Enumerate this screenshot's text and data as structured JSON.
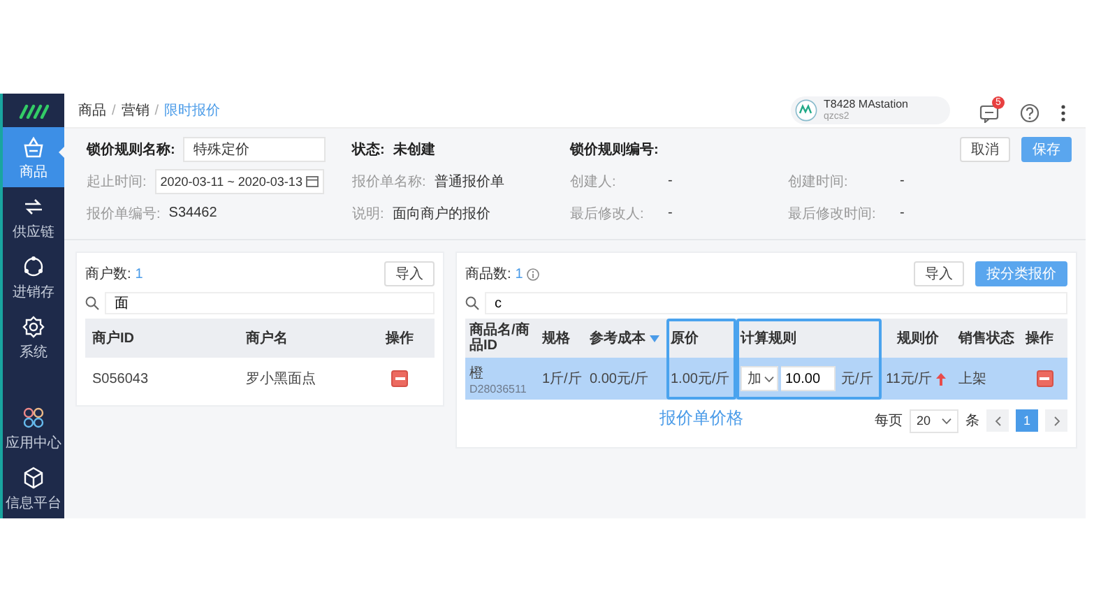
{
  "sidebar": {
    "items": [
      {
        "label": "商品",
        "selected": true
      },
      {
        "label": "供应链",
        "selected": false
      },
      {
        "label": "进销存",
        "selected": false
      },
      {
        "label": "系统",
        "selected": false
      }
    ],
    "bottom_items": [
      {
        "label": "应用中心",
        "selected": false
      },
      {
        "label": "信息平台",
        "selected": false
      }
    ]
  },
  "breadcrumb": {
    "separator": "/",
    "items": [
      {
        "label": "商品",
        "current": false
      },
      {
        "label": "营销",
        "current": false
      },
      {
        "label": "限时报价",
        "current": true
      }
    ]
  },
  "account": {
    "name": "T8428 MAstation",
    "sub": "qzcs2"
  },
  "notifications": {
    "badge": "5"
  },
  "form": {
    "name_label": "锁价规则名称:",
    "name_value": "特殊定价",
    "status_label": "状态:",
    "status_value": "未创建",
    "code_label": "锁价规则编号:",
    "fields": [
      {
        "label": "起止时间:",
        "value": "2020-03-11 ~ 2020-03-13",
        "kind": "date"
      },
      {
        "label": "报价单名称:",
        "value": "普通报价单",
        "kind": "text"
      },
      {
        "label": "创建人:",
        "value": "-",
        "kind": "text"
      },
      {
        "label": "创建时间:",
        "value": "-",
        "kind": "text"
      },
      {
        "label": "报价单编号:",
        "value": "S34462",
        "kind": "text"
      },
      {
        "label": "说明:",
        "value": "面向商户的报价",
        "kind": "text"
      },
      {
        "label": "最后修改人:",
        "value": "-",
        "kind": "text"
      },
      {
        "label": "最后修改时间:",
        "value": "-",
        "kind": "text"
      }
    ]
  },
  "actions": [
    {
      "label": "取消",
      "primary": false
    },
    {
      "label": "保存",
      "primary": true
    }
  ],
  "merchants": {
    "count_label": "商户数:",
    "count": "1",
    "buttons": [
      {
        "label": "导入",
        "primary": false
      }
    ],
    "search": "面",
    "columns": [
      "商户ID",
      "商户名",
      "操作"
    ],
    "rows": [
      {
        "id": "S056043",
        "name": "罗小黑面点",
        "selected": false
      }
    ]
  },
  "products": {
    "count_label": "商品数:",
    "count": "1",
    "buttons": [
      {
        "label": "导入",
        "primary": false
      },
      {
        "label": "按分类报价",
        "primary": true
      }
    ],
    "search": "c",
    "columns": [
      {
        "label": "商品名/商品ID",
        "sorted": false,
        "highlighted": false
      },
      {
        "label": "规格",
        "sorted": false,
        "highlighted": false
      },
      {
        "label": "参考成本",
        "sorted": true,
        "highlighted": false
      },
      {
        "label": "原价",
        "sorted": false,
        "highlighted": true
      },
      {
        "label": "计算规则",
        "sorted": false,
        "highlighted": true
      },
      {
        "label": "规则价",
        "sorted": false,
        "highlighted": false
      },
      {
        "label": "销售状态",
        "sorted": false,
        "highlighted": false
      },
      {
        "label": "操作",
        "sorted": false,
        "highlighted": false
      }
    ],
    "rows": [
      {
        "selected": true,
        "name": "橙",
        "id": "D28036511",
        "spec": "1斤/斤",
        "cost": "0.00元/斤",
        "price": "1.00元/斤",
        "rule": {
          "op": "加",
          "value": "10.00",
          "unit": "元/斤"
        },
        "rule_price": "11元/斤",
        "rising": true,
        "status": "上架"
      }
    ],
    "annotation": "报价单价格",
    "pagination": {
      "per_page_label": "每页",
      "per_page": "20",
      "unit": "条",
      "pages": [
        {
          "label": "1",
          "selected": true
        }
      ]
    }
  }
}
